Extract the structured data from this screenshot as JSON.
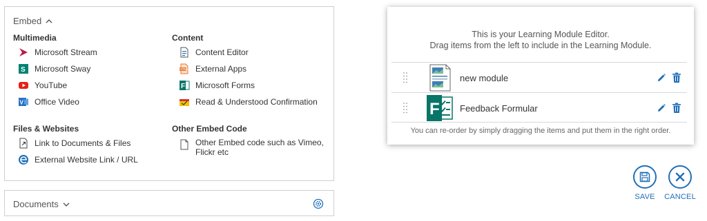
{
  "embed": {
    "header": "Embed",
    "sections": {
      "multimedia": {
        "title": "Multimedia",
        "items": [
          "Microsoft Stream",
          "Microsoft Sway",
          "YouTube",
          "Office Video"
        ]
      },
      "content": {
        "title": "Content",
        "items": [
          "Content Editor",
          "External Apps",
          "Microsoft Forms",
          "Read & Understood Confirmation"
        ]
      },
      "files": {
        "title": "Files & Websites",
        "items": [
          "Link to Documents & Files",
          "External Website Link / URL"
        ]
      },
      "other": {
        "title": "Other Embed Code",
        "items": [
          "Other Embed code such as Vimeo, Flickr etc"
        ]
      }
    }
  },
  "documents": {
    "header": "Documents"
  },
  "editor": {
    "intro_line1": "This is your Learning Module Editor.",
    "intro_line2": "Drag items from the left to include in the Learning Module.",
    "rows": [
      {
        "label": "new module",
        "icon": "document-thumbnail-icon"
      },
      {
        "label": "Feedback Formular",
        "icon": "microsoft-forms-icon"
      }
    ],
    "hint": "You can re-order by simply dragging the items and put them in the right order."
  },
  "actions": {
    "save": "SAVE",
    "cancel": "CANCEL"
  },
  "colors": {
    "accent": "#1f6fb8",
    "border": "#cfcfcf",
    "forms_green": "#077568",
    "youtube_red": "#e62117",
    "stream_magenta": "#bc1948",
    "sway_green": "#008272"
  }
}
